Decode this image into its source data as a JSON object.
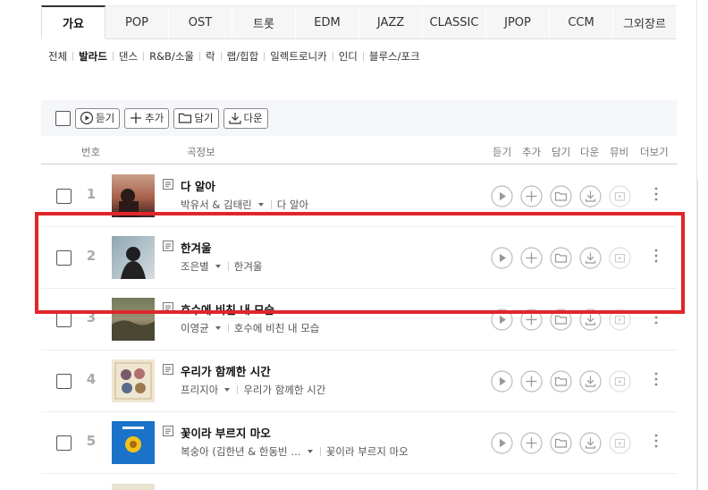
{
  "genre_tabs": [
    "가요",
    "POP",
    "OST",
    "트롯",
    "EDM",
    "JAZZ",
    "CLASSIC",
    "JPOP",
    "CCM",
    "그외장르"
  ],
  "active_genre": "가요",
  "sub_genres": [
    "전체",
    "발라드",
    "댄스",
    "R&B/소울",
    "락",
    "랩/힙합",
    "일렉트로니카",
    "인디",
    "블루스/포크"
  ],
  "active_sub_genre": "발라드",
  "toolbar": {
    "play_label": "듣기",
    "add_label": "추가",
    "save_label": "담기",
    "download_label": "다운"
  },
  "columns": {
    "number": "번호",
    "song_info": "곡정보",
    "play": "듣기",
    "add": "추가",
    "save": "담기",
    "download": "다운",
    "mv": "뮤비",
    "more": "더보기"
  },
  "songs": [
    {
      "rank": "1",
      "title": "다 알아",
      "artist": "박유서 & 김태린",
      "album": "다 알아"
    },
    {
      "rank": "2",
      "title": "한겨울",
      "artist": "조은별",
      "album": "한겨울"
    },
    {
      "rank": "3",
      "title": "호수에 비친 내 모습",
      "artist": "이영균",
      "album": "호수에 비친 내 모습"
    },
    {
      "rank": "4",
      "title": "우리가 함께한 시간",
      "artist": "프리지아",
      "album": "우리가 함께한 시간"
    },
    {
      "rank": "5",
      "title": "꽃이라 부르지 마오",
      "artist": "복숭아 (김한년 & 한동빈 …",
      "album": "꽃이라 부르지 마오"
    }
  ],
  "colors": {
    "highlight": "#e0262b",
    "toolbar_bg": "#f4f6f9"
  }
}
